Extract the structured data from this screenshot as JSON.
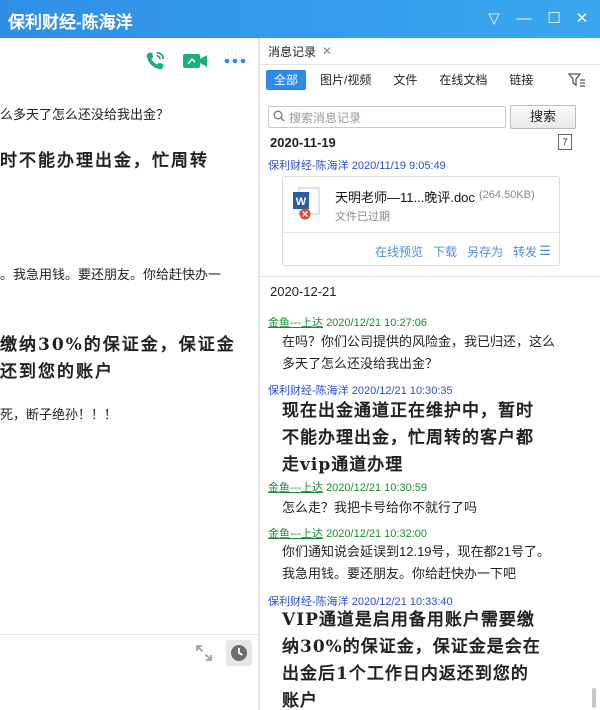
{
  "window": {
    "title": "保利财经-陈海洋"
  },
  "icons": {
    "phone": "phone-icon",
    "video": "video-icon",
    "more": "more-icon",
    "accent": "#1bb07a",
    "blue": "#2b8be8"
  },
  "left_chat": {
    "messages": [
      "么多天了怎么还没给我出金？",
      "时不能办理出金，忙周转",
      "。我急用钱。要还朋友。你给赶快办一",
      "缴纳30%的保证金，保证金",
      "还到您的账户",
      "死，断子绝孙！！！"
    ]
  },
  "history": {
    "tab_label": "消息记录",
    "filters": [
      "全部",
      "图片/视频",
      "文件",
      "在线文档",
      "链接"
    ],
    "search_placeholder": "搜索消息记录",
    "search_button": "搜索",
    "date1": "2020-11-19",
    "calendar_day": "7",
    "m1_sender": "保利财经-陈海洋",
    "m1_time": "2020/11/19 9:05:49",
    "file": {
      "name": "天明老师—11...晚评.doc",
      "size": "(264.50KB)",
      "status": "文件已过期",
      "actions": [
        "在线预览",
        "下载",
        "另存为",
        "转发"
      ]
    },
    "date2": "2020-12-21",
    "messages": [
      {
        "sender": "金鱼---上达",
        "time": "2020/12/21 10:27:06",
        "lines": [
          "在吗？你们公司提供的风险金，我已归还，这么",
          "多天了怎么还没给我出金？"
        ]
      },
      {
        "sender": "保利财经-陈海洋",
        "time": "2020/12/21 10:30:35",
        "lines": [
          "现在出金通道正在维护中，暂时",
          "不能办理出金，忙周转的客户都",
          "走vip通道办理"
        ]
      },
      {
        "sender": "金鱼---上达",
        "time": "2020/12/21 10:30:59",
        "lines": [
          "怎么走？我把卡号给你不就行了吗"
        ]
      },
      {
        "sender": "金鱼---上达",
        "time": "2020/12/21 10:32:00",
        "lines": [
          "你们通知说会延误到12.19号，现在都21号了。",
          "我急用钱。要还朋友。你给赶快办一下吧"
        ]
      },
      {
        "sender": "保利财经-陈海洋",
        "time": "2020/12/21 10:33:40",
        "lines": [
          "VIP通道是启用备用账户需要缴",
          "纳30%的保证金，保证金是会在",
          "出金后1个工作日内返还到您的",
          "账户"
        ]
      }
    ]
  }
}
